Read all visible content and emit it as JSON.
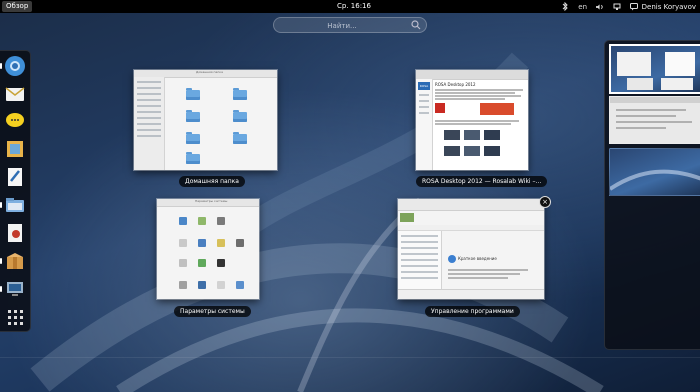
{
  "topbar": {
    "activities_label": "Обзор",
    "clock": "Ср. 16:16",
    "keyboard_layout": "en",
    "user_name": "Denis Koryavov"
  },
  "search": {
    "placeholder": "Найти..."
  },
  "dash": {
    "items": [
      {
        "name": "chromium-app",
        "running": true
      },
      {
        "name": "mail-app",
        "running": false
      },
      {
        "name": "messenger-app",
        "running": false
      },
      {
        "name": "notes-app",
        "running": false
      },
      {
        "name": "text-editor-app",
        "running": false
      },
      {
        "name": "file-manager-app",
        "running": true
      },
      {
        "name": "document-viewer-app",
        "running": false
      },
      {
        "name": "package-manager-app",
        "running": true
      },
      {
        "name": "system-settings-app",
        "running": true
      },
      {
        "name": "show-applications",
        "running": false
      }
    ]
  },
  "windows": [
    {
      "id": "home",
      "label": "Домашняя папка",
      "title_text": "Домашняя папка"
    },
    {
      "id": "browser",
      "label": "ROSA Desktop 2012 — Rosalab Wiki –...",
      "heading": "ROSA Desktop 2012",
      "logo_text": "ROSA"
    },
    {
      "id": "settings",
      "label": "Параметры системы",
      "title_text": "Параметры системы"
    },
    {
      "id": "software",
      "label": "Управление программами",
      "heading": "Краткое введение"
    }
  ],
  "close_glyph": "×",
  "colors": {
    "topbar": "#000000",
    "accent": "#3d6aa3",
    "label_bg": "#000000"
  }
}
